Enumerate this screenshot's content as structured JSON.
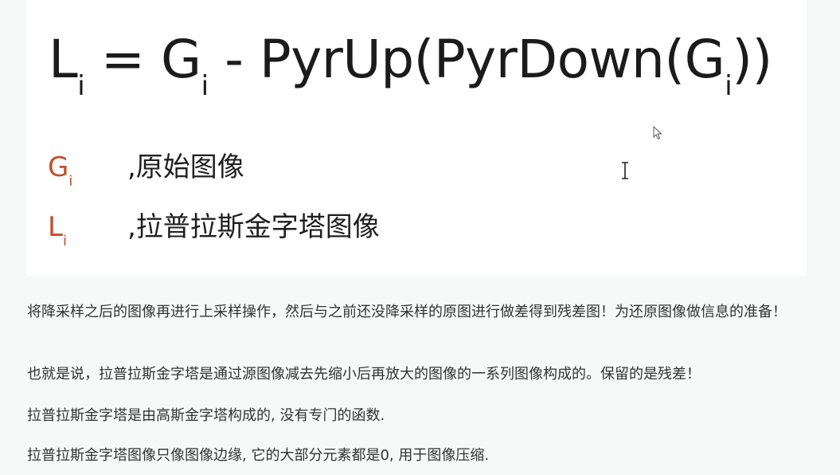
{
  "formula": {
    "lhs": "L",
    "lhs_sub": "i",
    "equals": "=",
    "g": "G",
    "g_sub": "i",
    "minus": "-",
    "func_open": "PyrUp(PyrDown(",
    "inner": "G",
    "inner_sub": "i",
    "func_close": "))"
  },
  "legend": [
    {
      "symbol": "G",
      "sub": "i",
      "description": ",原始图像"
    },
    {
      "symbol": "L",
      "sub": "i",
      "description": ",拉普拉斯金字塔图像"
    }
  ],
  "paragraphs": [
    "将降采样之后的图像再进行上采样操作，然后与之前还没降采样的原图进行做差得到残差图！为还原图像做信息的准备！",
    "也就是说，拉普拉斯金字塔是通过源图像减去先缩小后再放大的图像的一系列图像构成的。保留的是残差！",
    "拉普拉斯金字塔是由高斯金字塔构成的, 没有专门的函数.",
    "拉普拉斯金字塔图像只像图像边缘, 它的大部分元素都是0, 用于图像压缩."
  ],
  "colors": {
    "symbol_accent": "#c0502c",
    "card_background": "#ffffff",
    "page_background": "#f7f8f8"
  },
  "icons": {
    "mouse_pointer": "arrow-cursor-icon",
    "text_cursor": "ibeam-cursor-icon"
  }
}
